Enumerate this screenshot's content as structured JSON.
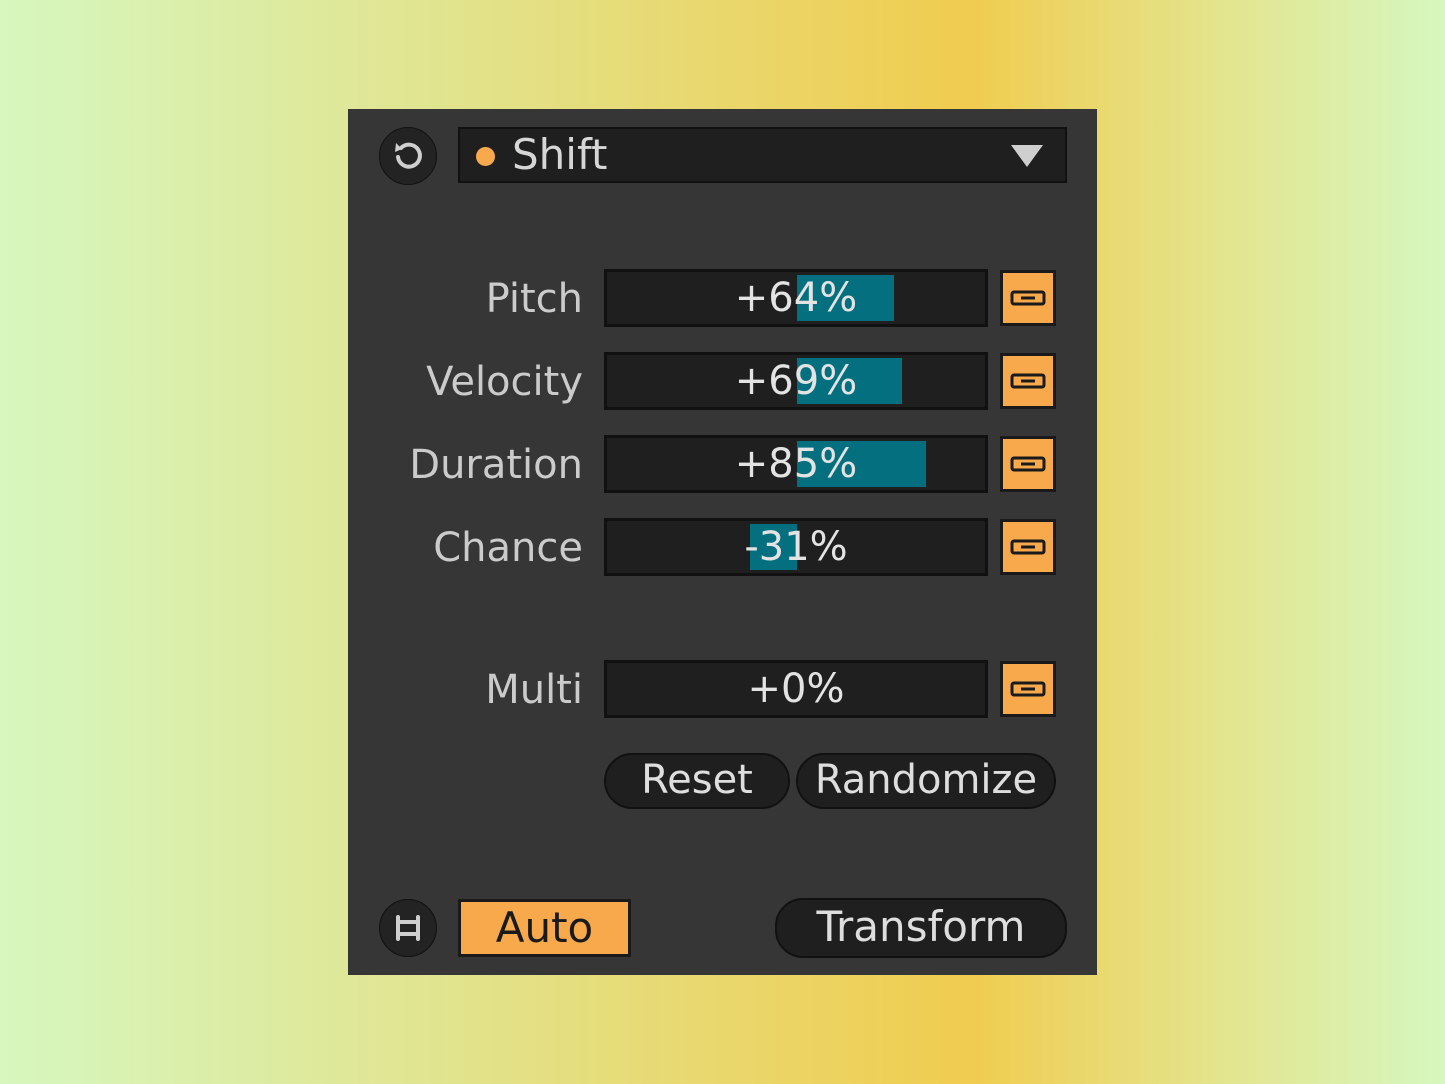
{
  "colors": {
    "panel": "#363636",
    "field": "#1f1f1f",
    "accent_orange": "#f7a94c",
    "fill_teal": "#04707f",
    "text": "#d6d6d6"
  },
  "header": {
    "reset_icon": "undo-circle-arrow-icon",
    "preset": {
      "status_dot_icon": "orange-dot-icon",
      "label": "Shift",
      "arrow_icon": "triangle-down-icon"
    }
  },
  "params": [
    {
      "label": "Pitch",
      "value": "+64%",
      "amount": 0.64
    },
    {
      "label": "Velocity",
      "value": "+69%",
      "amount": 0.69
    },
    {
      "label": "Duration",
      "value": "+85%",
      "amount": 0.85
    },
    {
      "label": "Chance",
      "value": "-31%",
      "amount": -0.31
    }
  ],
  "multi": {
    "label": "Multi",
    "value": "+0%",
    "amount": 0
  },
  "link_icon": "link-chain-icon",
  "buttons": {
    "reset": "Reset",
    "randomize": "Randomize"
  },
  "footer": {
    "loop_icon": "loop-brackets-icon",
    "auto_label": "Auto",
    "transform_label": "Transform"
  }
}
